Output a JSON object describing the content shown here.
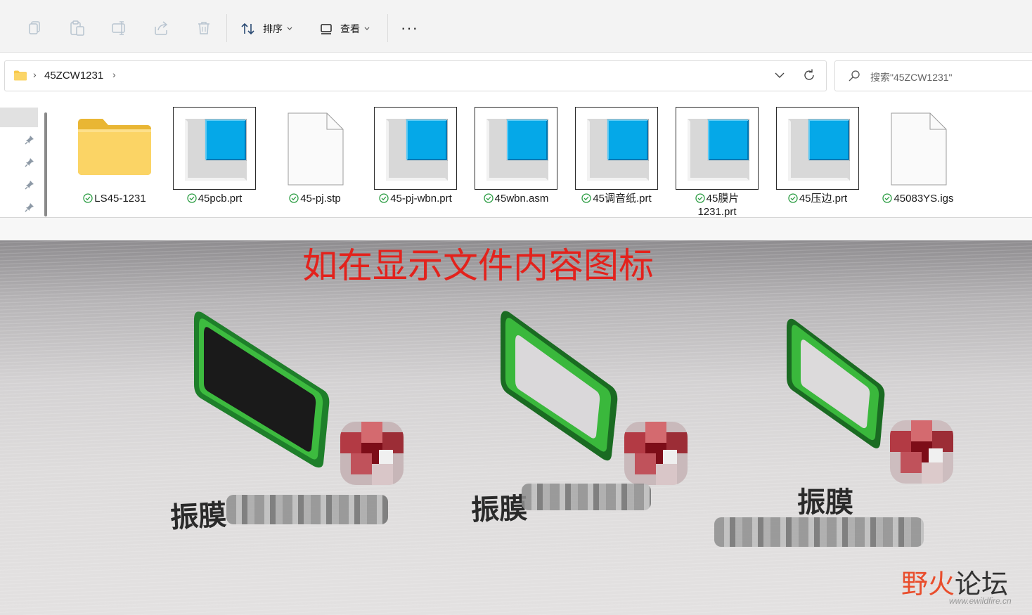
{
  "toolbar": {
    "icons": [
      "copy-icon",
      "paste-icon",
      "rename-icon",
      "share-icon",
      "delete-icon"
    ],
    "sort_label": "排序",
    "view_label": "查看",
    "more_label": "···"
  },
  "address": {
    "path": "45ZCW1231",
    "separator": "›"
  },
  "search": {
    "placeholder": "搜索\"45ZCW1231\""
  },
  "files": [
    {
      "name": "LS45-1231",
      "type": "folder"
    },
    {
      "name": "45pcb.prt",
      "type": "prt"
    },
    {
      "name": "45-pj.stp",
      "type": "generic"
    },
    {
      "name": "45-pj-wbn.prt",
      "type": "prt"
    },
    {
      "name": "45wbn.asm",
      "type": "prt"
    },
    {
      "name": "45调音纸.prt",
      "type": "prt"
    },
    {
      "name": "45膜片",
      "name_line2": "1231.prt",
      "type": "prt"
    },
    {
      "name": "45压边.prt",
      "type": "prt"
    },
    {
      "name": "45083YS.igs",
      "type": "generic"
    }
  ],
  "photo": {
    "caption": "如在显示文件内容图标",
    "labels": [
      "振膜",
      "振膜",
      "振膜"
    ]
  },
  "watermark": {
    "brand_a": "野火",
    "brand_b": "论坛",
    "url": "www.ewildfire.cn"
  },
  "colors": {
    "accent_blue": "#0ea5e9",
    "status_green": "#2e9e45",
    "caption_red": "#e3221c"
  }
}
